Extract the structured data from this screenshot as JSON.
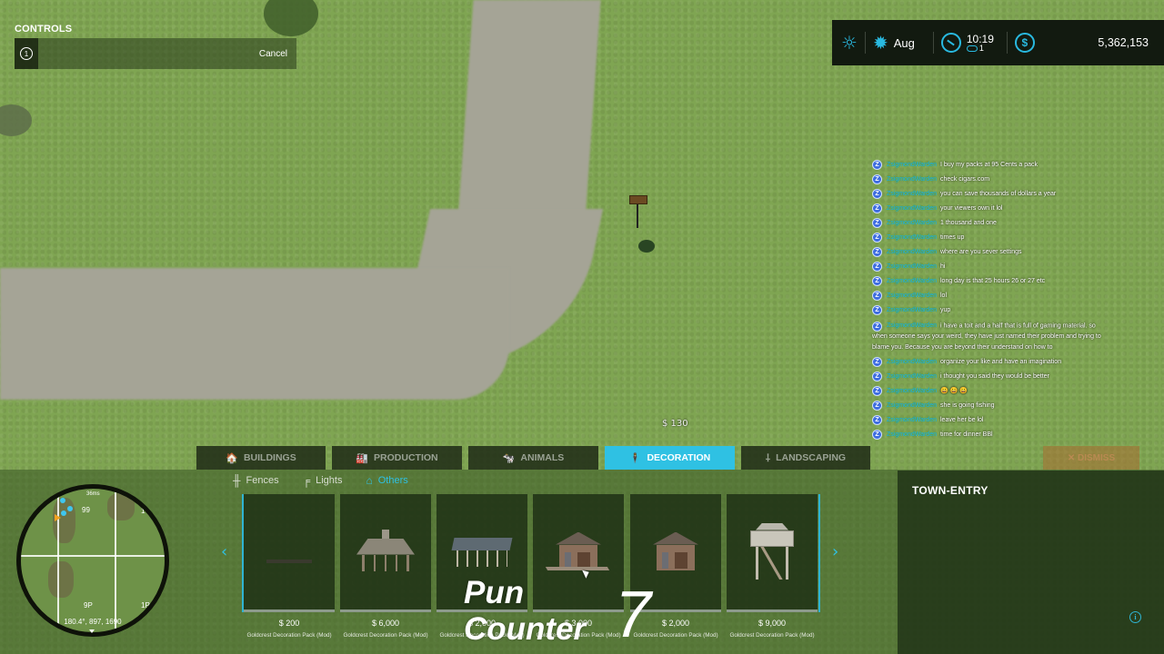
{
  "controls": {
    "title": "CONTROLS",
    "key": "1",
    "cancel_label": "Cancel"
  },
  "hud": {
    "weather_icon": "sun-icon",
    "season_icon": "season-sun-icon",
    "month": "Aug",
    "time": "10:19",
    "time_speed": "1",
    "money": "5,362,153",
    "accent_color": "#29b9e0"
  },
  "world": {
    "placement_price": "$ 130"
  },
  "chat": {
    "badge": "Z",
    "messages": [
      {
        "user": "ZsigmondWarden",
        "text": "I buy my packs at 95 Cents a pack"
      },
      {
        "user": "ZsigmondWarden",
        "text": "check cigars.com"
      },
      {
        "user": "ZsigmondWarden",
        "text": "you can save thousands of dollars a year"
      },
      {
        "user": "ZsigmondWarden",
        "text": "your viewers own it lol"
      },
      {
        "user": "ZsigmondWarden",
        "text": "1 thousand and one"
      },
      {
        "user": "ZsigmondWarden",
        "text": "times up"
      },
      {
        "user": "ZsigmondWarden",
        "text": "where are you sever settings"
      },
      {
        "user": "ZsigmondWarden",
        "text": "hi"
      },
      {
        "user": "ZsigmondWarden",
        "text": "long day is that 25 hours 26 or 27 etc"
      },
      {
        "user": "ZsigmondWarden",
        "text": "lol"
      },
      {
        "user": "ZsigmondWarden",
        "text": "yup"
      },
      {
        "user": "ZsigmondWarden",
        "text": "i have a toit and a half that is full of gaming material. so when someone says your weird, they have just named their problem and trying to blame you. Because you are beyond their understand on how to"
      },
      {
        "user": "ZsigmondWarden",
        "text": "organize your like and have an imagination"
      },
      {
        "user": "ZsigmondWarden",
        "text": "i thought you said they would be better"
      },
      {
        "user": "ZsigmondWarden",
        "text": "😀 😀 😀"
      },
      {
        "user": "ZsigmondWarden",
        "text": "she is going fishing"
      },
      {
        "user": "ZsigmondWarden",
        "text": "leave her be lol"
      },
      {
        "user": "ZsigmondWarden",
        "text": "time for dinner BBl"
      }
    ],
    "dismiss_label": "✕ DISMISS"
  },
  "categories": {
    "tabs": [
      {
        "label": "BUILDINGS",
        "icon": "building-icon",
        "glyph": "🏠",
        "active": false
      },
      {
        "label": "PRODUCTION",
        "icon": "production-icon",
        "glyph": "🏭",
        "active": false
      },
      {
        "label": "ANIMALS",
        "icon": "animal-icon",
        "glyph": "🐄",
        "active": false
      },
      {
        "label": "DECORATION",
        "icon": "decoration-icon",
        "glyph": "🕴",
        "active": true
      },
      {
        "label": "LANDSCAPING",
        "icon": "shovel-icon",
        "glyph": "⸸",
        "active": false
      }
    ],
    "subtabs": [
      {
        "label": "Fences",
        "icon": "fence-icon",
        "glyph": "╫",
        "active": false
      },
      {
        "label": "Lights",
        "icon": "lamp-icon",
        "glyph": "╒",
        "active": false
      },
      {
        "label": "Others",
        "icon": "others-icon",
        "glyph": "⌂",
        "active": true
      }
    ]
  },
  "items": [
    {
      "model": "bench",
      "price": "$ 200",
      "source": "Goldcrest Decoration Pack (Mod)"
    },
    {
      "model": "gazebo",
      "price": "$ 6,000",
      "source": "Goldcrest Decoration Pack (Mod)"
    },
    {
      "model": "open-shed",
      "price": "$ 2,000",
      "source": "Goldcrest Decoration Pack (Mod)"
    },
    {
      "model": "cabin-with-deck",
      "price": "$ 3,000",
      "source": "Goldcrest Decoration Pack (Mod)"
    },
    {
      "model": "cabin",
      "price": "$ 2,000",
      "source": "Goldcrest Decoration Pack (Mod)"
    },
    {
      "model": "lookout-tower",
      "price": "$ 9,000",
      "source": "Goldcrest Decoration Pack (Mod)"
    }
  ],
  "carousel": {
    "prev_glyph": "‹",
    "next_glyph": "›"
  },
  "info_panel": {
    "title": "TOWN-ENTRY",
    "info_glyph": "i"
  },
  "minimap": {
    "scale": "36ms",
    "field_top": "99",
    "field_bottom": "9P",
    "field_right_top": "1",
    "field_right_bottom": "1P",
    "coords": "180.4°, 897, 1690"
  },
  "overlay": {
    "line1": "Pun",
    "line2": "Counter",
    "count": "7"
  }
}
